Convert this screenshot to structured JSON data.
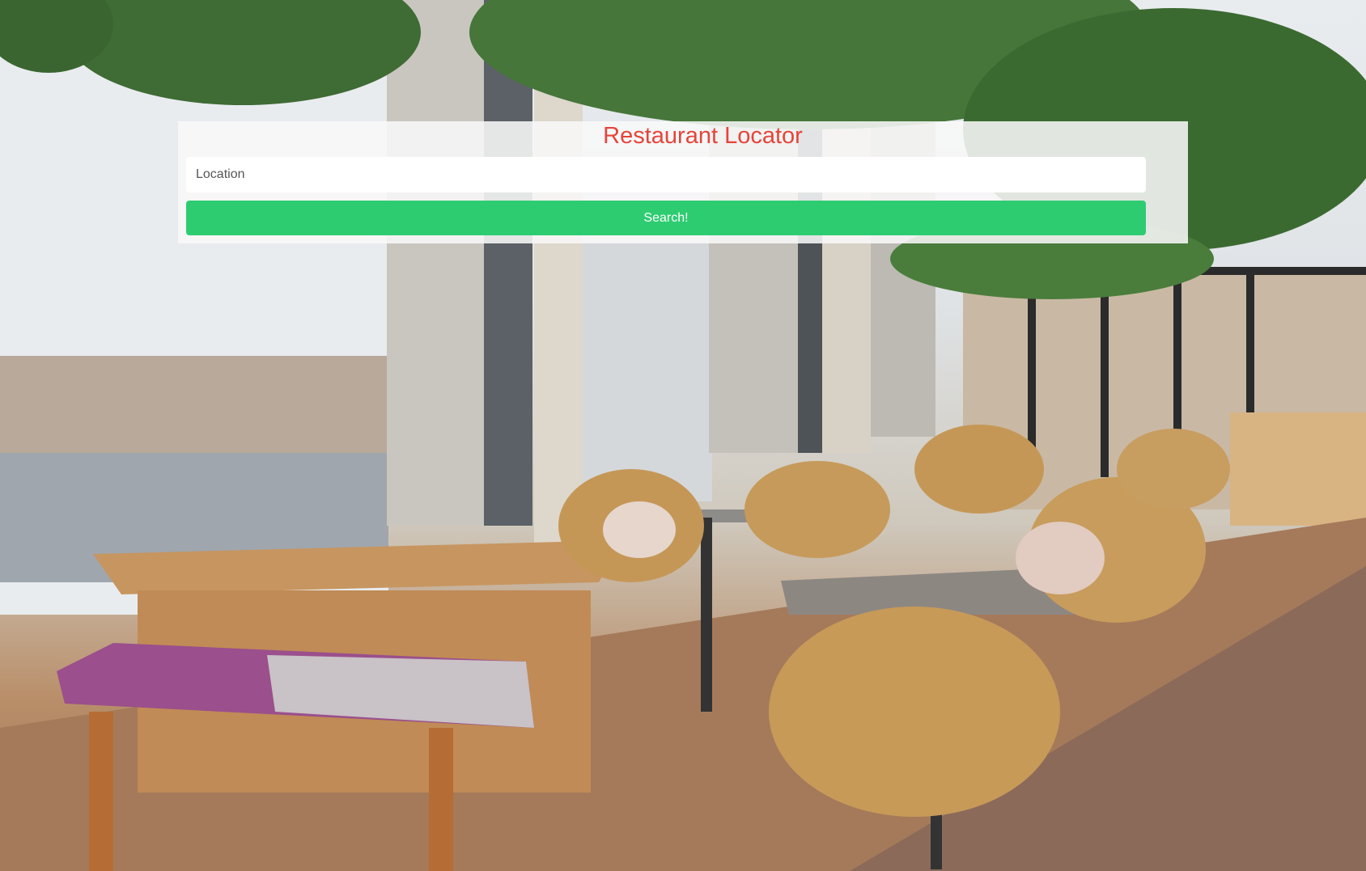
{
  "page": {
    "title": "Restaurant Locator"
  },
  "search": {
    "placeholder": "Location",
    "value": "",
    "button_label": "Search!"
  },
  "colors": {
    "title": "#e5453a",
    "button": "#2ecc71",
    "button_text": "#ffffff",
    "panel": "#f8f8f8"
  },
  "background": {
    "subject": "restaurant-interior-photo"
  }
}
